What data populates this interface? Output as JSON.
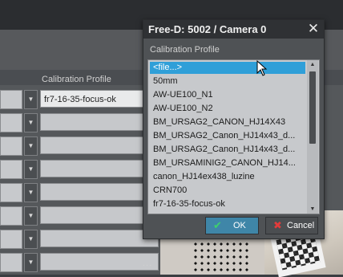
{
  "background": {
    "column_header": "Calibration Profile",
    "first_row_value": "fr7-16-35-focus-ok",
    "ellipsis": "..."
  },
  "dialog": {
    "title": "Free-D: 5002 / Camera 0",
    "label": "Calibration Profile",
    "items": [
      "<file...>",
      "50mm",
      "AW-UE100_N1",
      "AW-UE100_N2",
      "BM_URSAG2_CANON_HJ14X43",
      "BM_URSAG2_Canon_HJ14x43_d...",
      "BM_URSAG2_Canon_HJ14x43_d...",
      "BM_URSAMINIG2_CANON_HJ14...",
      "canon_HJ14ex438_luzine",
      "CRN700",
      "fr7-16-35-focus-ok"
    ],
    "selected_index": 0,
    "ok_label": "OK",
    "cancel_label": "Cancel",
    "icons": {
      "close": "close-icon",
      "ok": "check-icon",
      "cancel": "x-icon"
    },
    "colors": {
      "selection": "#2f9fd8",
      "ok_button": "#3f86a8",
      "ok_icon": "#3ed26a",
      "cancel_icon": "#e23b3b"
    }
  }
}
